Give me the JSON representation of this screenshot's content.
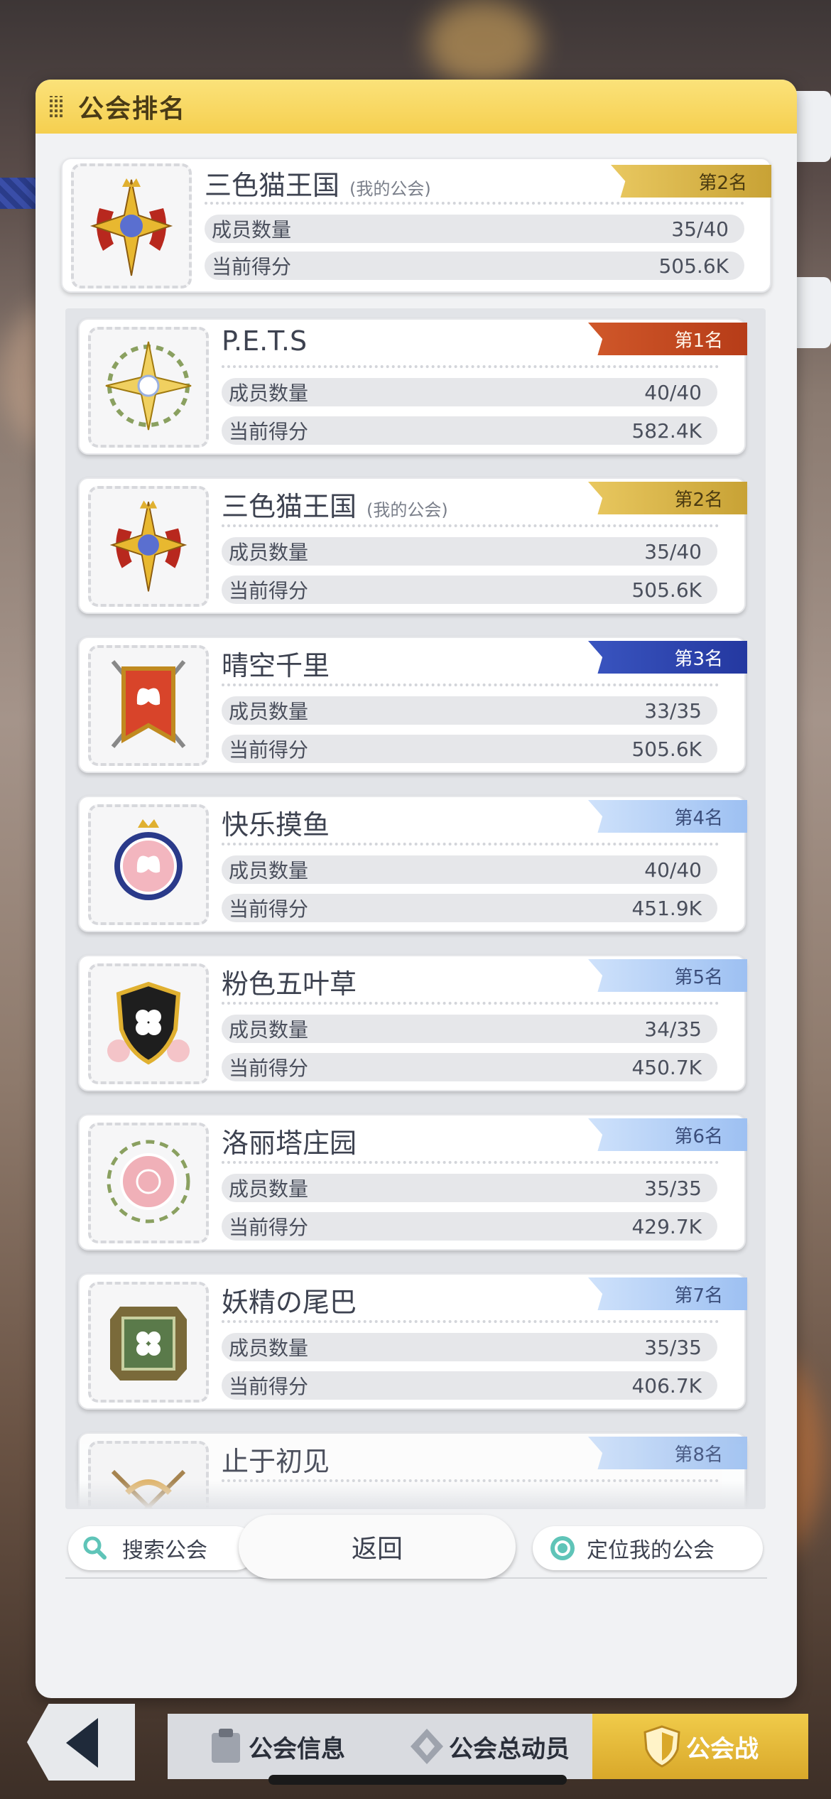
{
  "panel": {
    "title": "公会排名"
  },
  "my_guild": {
    "name": "三色猫王国",
    "mine_tag": "(我的公会)",
    "rank": "第2名",
    "members_label": "成员数量",
    "members": "35/40",
    "score_label": "当前得分",
    "score": "505.6K",
    "emblem": "gold-red-compass-emblem"
  },
  "rows": [
    {
      "name": "P.E.T.S",
      "mine_tag": "",
      "rank": "第1名",
      "tier": "r1",
      "members_label": "成员数量",
      "members": "40/40",
      "score_label": "当前得分",
      "score": "582.4K",
      "emblem": "white-star-flower-emblem"
    },
    {
      "name": "三色猫王国",
      "mine_tag": "(我的公会)",
      "rank": "第2名",
      "tier": "r2",
      "members_label": "成员数量",
      "members": "35/40",
      "score_label": "当前得分",
      "score": "505.6K",
      "emblem": "gold-red-compass-emblem"
    },
    {
      "name": "晴空千里",
      "mine_tag": "",
      "rank": "第3名",
      "tier": "r3",
      "members_label": "成员数量",
      "members": "33/35",
      "score_label": "当前得分",
      "score": "505.6K",
      "emblem": "red-banner-butterfly-emblem"
    },
    {
      "name": "快乐摸鱼",
      "mine_tag": "",
      "rank": "第4名",
      "tier": "rn",
      "members_label": "成员数量",
      "members": "40/40",
      "score_label": "当前得分",
      "score": "451.9K",
      "emblem": "pink-seal-butterfly-emblem"
    },
    {
      "name": "粉色五叶草",
      "mine_tag": "",
      "rank": "第5名",
      "tier": "rn",
      "members_label": "成员数量",
      "members": "34/35",
      "score_label": "当前得分",
      "score": "450.7K",
      "emblem": "black-shield-clover-emblem"
    },
    {
      "name": "洛丽塔庄园",
      "mine_tag": "",
      "rank": "第6名",
      "tier": "rn",
      "members_label": "成员数量",
      "members": "35/35",
      "score_label": "当前得分",
      "score": "429.7K",
      "emblem": "pink-seal-flower-emblem"
    },
    {
      "name": "妖精の尾巴",
      "mine_tag": "",
      "rank": "第7名",
      "tier": "rn",
      "members_label": "成员数量",
      "members": "35/35",
      "score_label": "当前得分",
      "score": "406.7K",
      "emblem": "green-frame-clover-emblem"
    },
    {
      "name": "止于初见",
      "mine_tag": "",
      "rank": "第8名",
      "tier": "rn",
      "members_label": "",
      "members": "",
      "score_label": "",
      "score": "",
      "emblem": "crossed-weapons-emblem"
    }
  ],
  "search_button": {
    "label": "搜索公会",
    "icon": "search-icon"
  },
  "locate_button": {
    "label": "定位我的公会",
    "icon": "target-icon"
  },
  "back_button": {
    "label": "返回"
  },
  "bottom_nav": {
    "back_icon": "back-arrow-icon",
    "tabs": [
      "公会信息",
      "公会总动员",
      "公会战"
    ]
  },
  "colors": {
    "header": "#f5cf4f",
    "rank1": "#c0441c",
    "rank2": "#d4b04a",
    "rank3": "#2c40aa",
    "rank_other": "#a9c8f3",
    "active_tab": "#e3b734"
  }
}
